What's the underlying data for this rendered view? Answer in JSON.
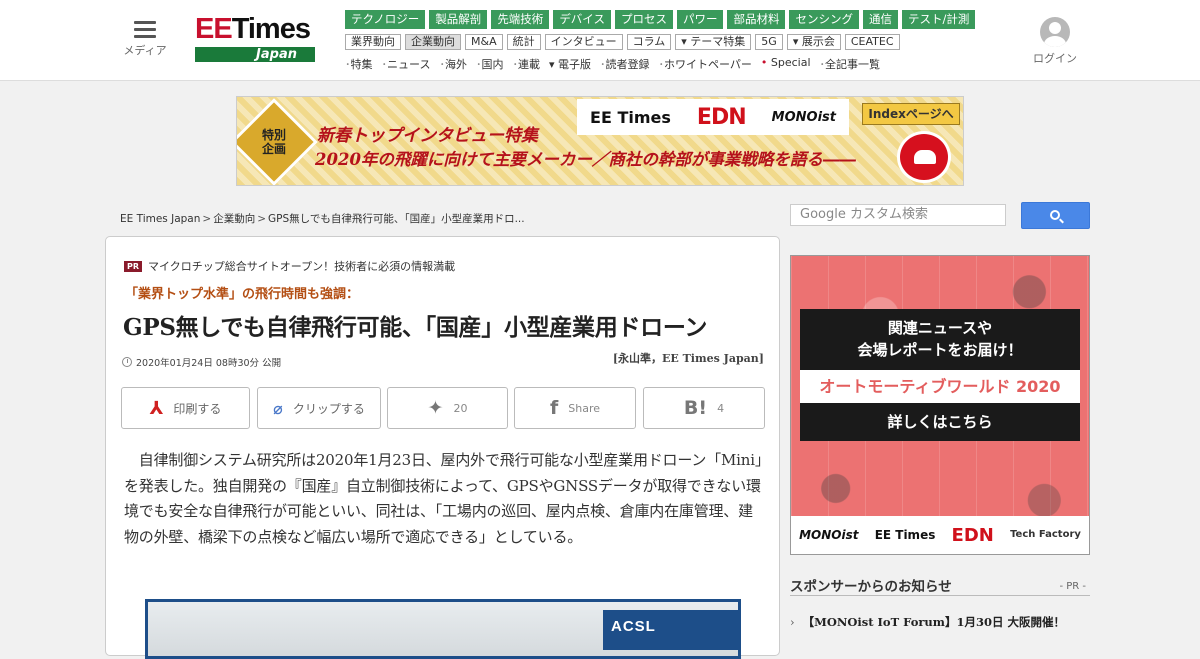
{
  "header": {
    "menu_label": "メディア",
    "logo_top": "Times",
    "logo_prefix": "EE",
    "logo_bottom": "Japan",
    "login_label": "ログイン",
    "nav_primary": [
      "テクノロジー",
      "製品解剖",
      "先端技術",
      "デバイス",
      "プロセス",
      "パワー",
      "部品材料",
      "センシング",
      "通信",
      "テスト/計測"
    ],
    "nav_secondary": [
      "業界動向",
      "企業動向",
      "M&A",
      "統計",
      "インタビュー",
      "コラム",
      "▾ テーマ特集",
      "5G",
      "▾ 展示会",
      "CEATEC"
    ],
    "nav_secondary_active": "企業動向",
    "nav_links": [
      "特集",
      "ニュース",
      "海外",
      "国内",
      "連載",
      "▾ 電子版",
      "読者登録",
      "ホワイトペーパー",
      "Special",
      "全記事一覧"
    ],
    "nav_links_special": "Special",
    "accent_green": "#3a9a5b",
    "accent_red": "#c8102e"
  },
  "banner": {
    "badge": "特別\n企画",
    "line1": "新春トップインタビュー特集",
    "line2": "2020年の飛躍に向けて主要メーカー／商社の幹部が事業戦略を語る――",
    "logos": [
      "EE Times",
      "EDN",
      "MONOist"
    ],
    "index_button": "Indexページへ"
  },
  "breadcrumb": {
    "items": [
      "EE Times Japan",
      "企業動向",
      "GPS無しでも自律飛行可能、「国産」小型産業用ドロ..."
    ],
    "separator": ">"
  },
  "article": {
    "pr_badge": "PR",
    "pr_text": "マイクロチップ総合サイトオープン！技術者に必須の情報満載",
    "subhead": "「業界トップ水準」の飛行時間も強調：",
    "title": "GPS無しでも自律飛行可能、「国産」小型産業用ドローン",
    "date": "2020年01月24日 08時30分 公開",
    "author": "[永山準，EE Times Japan]",
    "share": {
      "print": "印刷する",
      "clip": "クリップする",
      "twitter_count": "20",
      "facebook": "Share",
      "hatena_count": "4"
    },
    "body": "　自律制御システム研究所は2020年1月23日、屋内外で飛行可能な小型産業用ドローン「Mini」を発表した。独自開発の『国産』自立制御技術によって、GPSやGNSSデータが取得できない環境でも安全な自律飛行が可能といい、同社は、「工場内の巡回、屋内点検、倉庫内在庫管理、建物の外壁、橋梁下の点検など幅広い場所で適応できる」としている。",
    "photo_text": "ACSL"
  },
  "sidebar": {
    "search_placeholder": "Google カスタム検索",
    "ad": {
      "box1": "関連ニュースや\n会場レポートをお届け！",
      "box2": "オートモーティブワールド 2020",
      "box3": "詳しくはこちら",
      "footer_logos": [
        "MONOist",
        "EE Times",
        "EDN",
        "Tech Factory"
      ]
    },
    "sponsor_title": "スポンサーからのお知らせ",
    "sponsor_pr": "- PR -",
    "sponsor_item": "【MONOist IoT Forum】1月30日 大阪開催！"
  }
}
